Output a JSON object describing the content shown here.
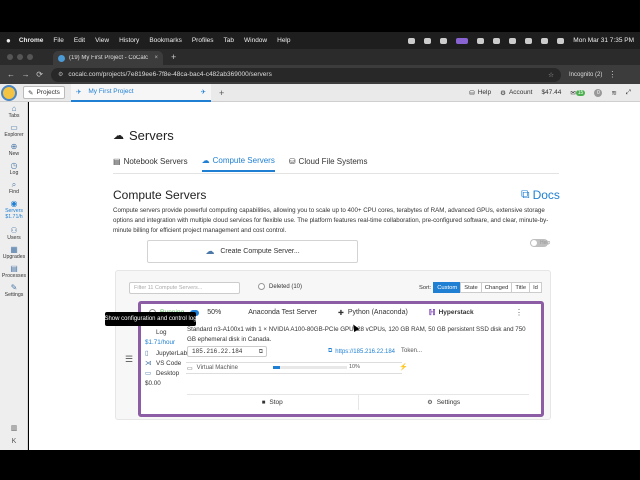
{
  "menubar": {
    "apple": "",
    "app": "Chrome",
    "items": [
      "File",
      "Edit",
      "View",
      "History",
      "Bookmarks",
      "Profiles",
      "Tab",
      "Window",
      "Help"
    ],
    "datetime": "Mon Mar 31  7:35 PM"
  },
  "browser": {
    "tab_title": "(19) My First Project - CoCalc",
    "tab_close": "×",
    "new_tab": "+",
    "url": "cocalc.com/projects/7e819ee6-7f8e-48ca-bac4-c482ab369000/servers",
    "incognito": "Incognito (2)",
    "back": "←",
    "forward": "→",
    "reload": "⟳"
  },
  "appbar": {
    "projects": "Projects",
    "project_tab": "My First Project",
    "add": "+",
    "help": "Help",
    "account": "Account",
    "balance": "$47.44",
    "notif_count": "6",
    "notif_badge": "15",
    "zero": "0"
  },
  "sidebar": {
    "items": [
      {
        "label": "Tabs",
        "icon": "home-icon"
      },
      {
        "label": "Explorer",
        "icon": "folder-icon"
      },
      {
        "label": "New",
        "icon": "plus-icon"
      },
      {
        "label": "Log",
        "icon": "history-icon"
      },
      {
        "label": "Find",
        "icon": "search-icon"
      },
      {
        "label": "Servers",
        "icon": "servers-icon",
        "cost": "$1.71/h"
      },
      {
        "label": "Users",
        "icon": "users-icon"
      },
      {
        "label": "Upgrades",
        "icon": "upgrades-icon"
      },
      {
        "label": "Processes",
        "icon": "processes-icon"
      },
      {
        "label": "Settings",
        "icon": "wrench-icon"
      }
    ],
    "bottom_k": "K"
  },
  "page": {
    "title": "Servers",
    "tabs": [
      "Notebook Servers",
      "Compute Servers",
      "Cloud File Systems"
    ],
    "section_title": "Compute Servers",
    "docs": "Docs",
    "description": "Compute servers provide powerful computing capabilities, allowing you to scale up to 400+ CPU cores, terabytes of RAM, advanced GPUs, extensive storage options and integration with multiple cloud services for flexible use. The platform features real-time collaboration, pre-configured software, and clear, minute-by-minute billing for efficient project management and cost control.",
    "help_toggle": "Help",
    "create_button": "Create Compute Server...",
    "filter_placeholder": "Filter 11 Compute Servers...",
    "deleted": "Deleted (10)",
    "sort_label": "Sort:",
    "sort_options": [
      "Custom",
      "State",
      "Changed",
      "Title",
      "Id"
    ]
  },
  "server": {
    "status": "Running",
    "progress": "50%",
    "title": "Anaconda Test Server",
    "image": "Python (Anaconda)",
    "provider": "Hyperstack",
    "specs": "Standard n3-A100x1 with 1 × NVIDIA A100-80GB-PCIe GPU, 28 vCPUs, 120 GB RAM, 50 GB persistent SSD disk and 750 GB ephemeral disk in Canada.",
    "ip": "185.216.22.184",
    "ip_link": "https://185.216.22.184",
    "token": "Token...",
    "side": [
      "Log",
      "$1.71/hour",
      "JupyterLab",
      "VS Code",
      "Desktop",
      "$0.00"
    ],
    "vm_label": "Virtual Machine",
    "vm_progress": "10%",
    "vm_progress_value": 0.1,
    "stop": "Stop",
    "settings": "Settings",
    "tooltip": "Show configuration and control log",
    "accent_color": "#8c5da5"
  }
}
